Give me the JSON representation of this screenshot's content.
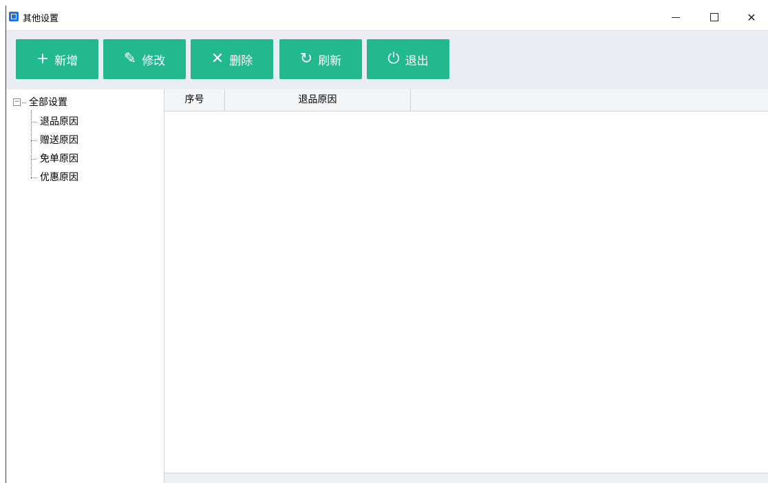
{
  "window": {
    "title": "其他设置",
    "controls": {
      "minimize": "–",
      "maximize": "□",
      "close": "✕"
    }
  },
  "toolbar": {
    "accent": "#22b98f",
    "buttons": [
      {
        "label": "新增",
        "icon": "plus-icon",
        "glyph": "+"
      },
      {
        "label": "修改",
        "icon": "pencil-icon",
        "glyph": "✎"
      },
      {
        "label": "删除",
        "icon": "close-x-icon",
        "glyph": "✕"
      },
      {
        "label": "刷新",
        "icon": "refresh-icon",
        "glyph": "↻"
      },
      {
        "label": "退出",
        "icon": "power-icon",
        "glyph": "⏻"
      }
    ]
  },
  "tree": {
    "root": "全部设置",
    "root_expander": "−",
    "children": [
      "退品原因",
      "赠送原因",
      "免单原因",
      "优惠原因"
    ]
  },
  "grid": {
    "columns": [
      "序号",
      "退品原因"
    ],
    "rows": []
  }
}
